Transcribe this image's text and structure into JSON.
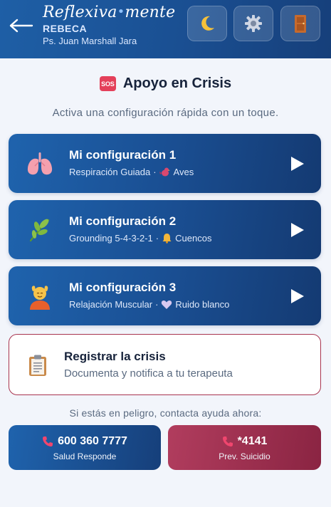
{
  "header": {
    "brand_left": "Reflexiva",
    "brand_right": "mente",
    "patient_name": "REBECA",
    "therapist": "Ps. Juan Marshall Jara"
  },
  "section": {
    "title": "Apoyo en Crisis",
    "sos_badge": "SOS",
    "subtitle": "Activa una configuración rápida con un toque."
  },
  "configs": [
    {
      "title": "Mi configuración 1",
      "technique": "Respiración Guiada",
      "separator": "·",
      "sound": "Aves",
      "icon": "lungs-icon",
      "sound_icon": "bird-icon"
    },
    {
      "title": "Mi configuración 2",
      "technique": "Grounding 5-4-3-2-1",
      "separator": "·",
      "sound": "Cuencos",
      "icon": "leaf-icon",
      "sound_icon": "bell-icon"
    },
    {
      "title": "Mi configuración 3",
      "technique": "Relajación Muscular",
      "separator": "·",
      "sound": "Ruido blanco",
      "icon": "massage-icon",
      "sound_icon": "heart-icon"
    }
  ],
  "register": {
    "title": "Registrar la crisis",
    "subtitle": "Documenta y notifica a tu terapeuta"
  },
  "danger_text": "Si estás en peligro, contacta ayuda ahora:",
  "help_lines": [
    {
      "number": "600 360 7777",
      "label": "Salud Responde"
    },
    {
      "number": "*4141",
      "label": "Prev. Suicidio"
    }
  ],
  "colors": {
    "primary": "#1a4f93",
    "crisis": "#a8344f",
    "background": "#f2f5fb"
  }
}
